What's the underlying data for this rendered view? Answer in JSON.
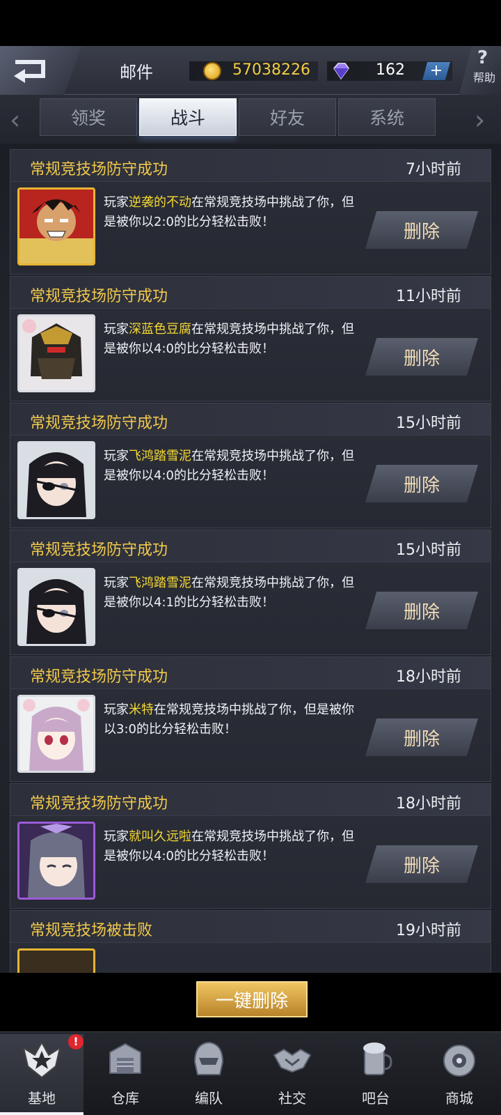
{
  "header": {
    "title": "邮件",
    "gold": "57038226",
    "gems": "162",
    "plus": "+",
    "help_icon": "?",
    "help_label": "帮助"
  },
  "tabs": [
    {
      "label": "领奖",
      "active": false
    },
    {
      "label": "战斗",
      "active": true
    },
    {
      "label": "好友",
      "active": false
    },
    {
      "label": "系统",
      "active": false
    }
  ],
  "mails": [
    {
      "title": "常规竞技场防守成功",
      "time": "7小时前",
      "prefix": "玩家",
      "player": "逆袭的不动",
      "text": "在常规竞技场中挑战了你，但是被你以2:0的比分轻松击败！",
      "avatar": "dark-haired-man-avatar",
      "delete": "删除"
    },
    {
      "title": "常规竞技场防守成功",
      "time": "11小时前",
      "prefix": "玩家",
      "player": "深蓝色豆腐",
      "text": "在常规竞技场中挑战了你，但是被你以4:0的比分轻松击败！",
      "avatar": "armored-robot-avatar",
      "delete": "删除"
    },
    {
      "title": "常规竞技场防守成功",
      "time": "15小时前",
      "prefix": "玩家",
      "player": "飞鸿踏雪泥",
      "text": "在常规竞技场中挑战了你，但是被你以4:0的比分轻松击败！",
      "avatar": "eyepatch-girl-avatar",
      "delete": "删除"
    },
    {
      "title": "常规竞技场防守成功",
      "time": "15小时前",
      "prefix": "玩家",
      "player": "飞鸿踏雪泥",
      "text": "在常规竞技场中挑战了你，但是被你以4:1的比分轻松击败！",
      "avatar": "eyepatch-girl-avatar",
      "delete": "删除"
    },
    {
      "title": "常规竞技场防守成功",
      "time": "18小时前",
      "prefix": "玩家",
      "player": "米特",
      "text": "在常规竞技场中挑战了你，但是被你以3:0的比分轻松击败！",
      "avatar": "pink-haired-girl-avatar",
      "delete": "删除"
    },
    {
      "title": "常规竞技场防守成功",
      "time": "18小时前",
      "prefix": "玩家",
      "player": "就叫久远啦",
      "text": "在常规竞技场中挑战了你，但是被你以4:0的比分轻松击败！",
      "avatar": "grey-haired-girl-avatar",
      "delete": "删除"
    },
    {
      "title": "常规竞技场被击败",
      "time": "19小时前"
    }
  ],
  "delete_all": "一键删除",
  "nav": [
    {
      "label": "基地",
      "icon": "base-emblem-icon",
      "active": true,
      "badge": "!"
    },
    {
      "label": "仓库",
      "icon": "warehouse-icon"
    },
    {
      "label": "编队",
      "icon": "squad-helmet-icon"
    },
    {
      "label": "社交",
      "icon": "handshake-icon"
    },
    {
      "label": "吧台",
      "icon": "drink-icon"
    },
    {
      "label": "商城",
      "icon": "shop-robot-icon"
    }
  ]
}
